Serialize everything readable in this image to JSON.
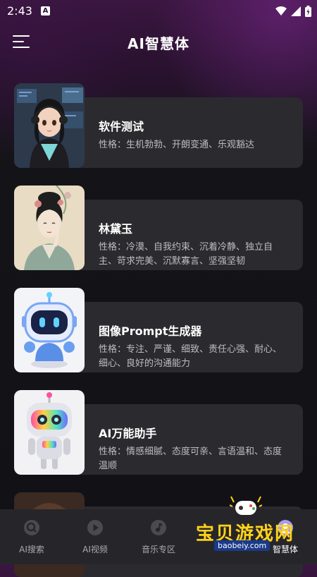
{
  "status": {
    "time": "2:43",
    "badge": "A"
  },
  "header": {
    "title": "AI智慧体"
  },
  "cards": [
    {
      "title": "软件测试",
      "desc": "性格：生机勃勃、开朗变通、乐观豁达",
      "image": "anime-girl-headphones"
    },
    {
      "title": "林黛玉",
      "desc": "性格：冷漠、自我约束、沉着冷静、独立自主、苛求完美、沉默寡言、坚强坚韧",
      "image": "chinese-painting-woman"
    },
    {
      "title": "图像Prompt生成器",
      "desc": "性格：专注、严谨、细致、责任心强、耐心、细心、良好的沟通能力",
      "image": "blue-robot"
    },
    {
      "title": "AI万能助手",
      "desc": "性格：情感细腻、态度可亲、言语温和、态度温顺",
      "image": "rainbow-robot"
    }
  ],
  "nav": [
    {
      "label": "AI搜索",
      "icon": "search-icon"
    },
    {
      "label": "AI视频",
      "icon": "play-icon"
    },
    {
      "label": "音乐专区",
      "icon": "music-note-icon"
    },
    {
      "label": "智慧体",
      "icon": "agent-icon"
    }
  ],
  "watermark": {
    "text": "宝贝游戏网",
    "url": "baobeiy.com"
  },
  "colors": {
    "card_bg": "#2b2b2f",
    "nav_bg": "#26262a",
    "accent": "#ffd21a"
  }
}
